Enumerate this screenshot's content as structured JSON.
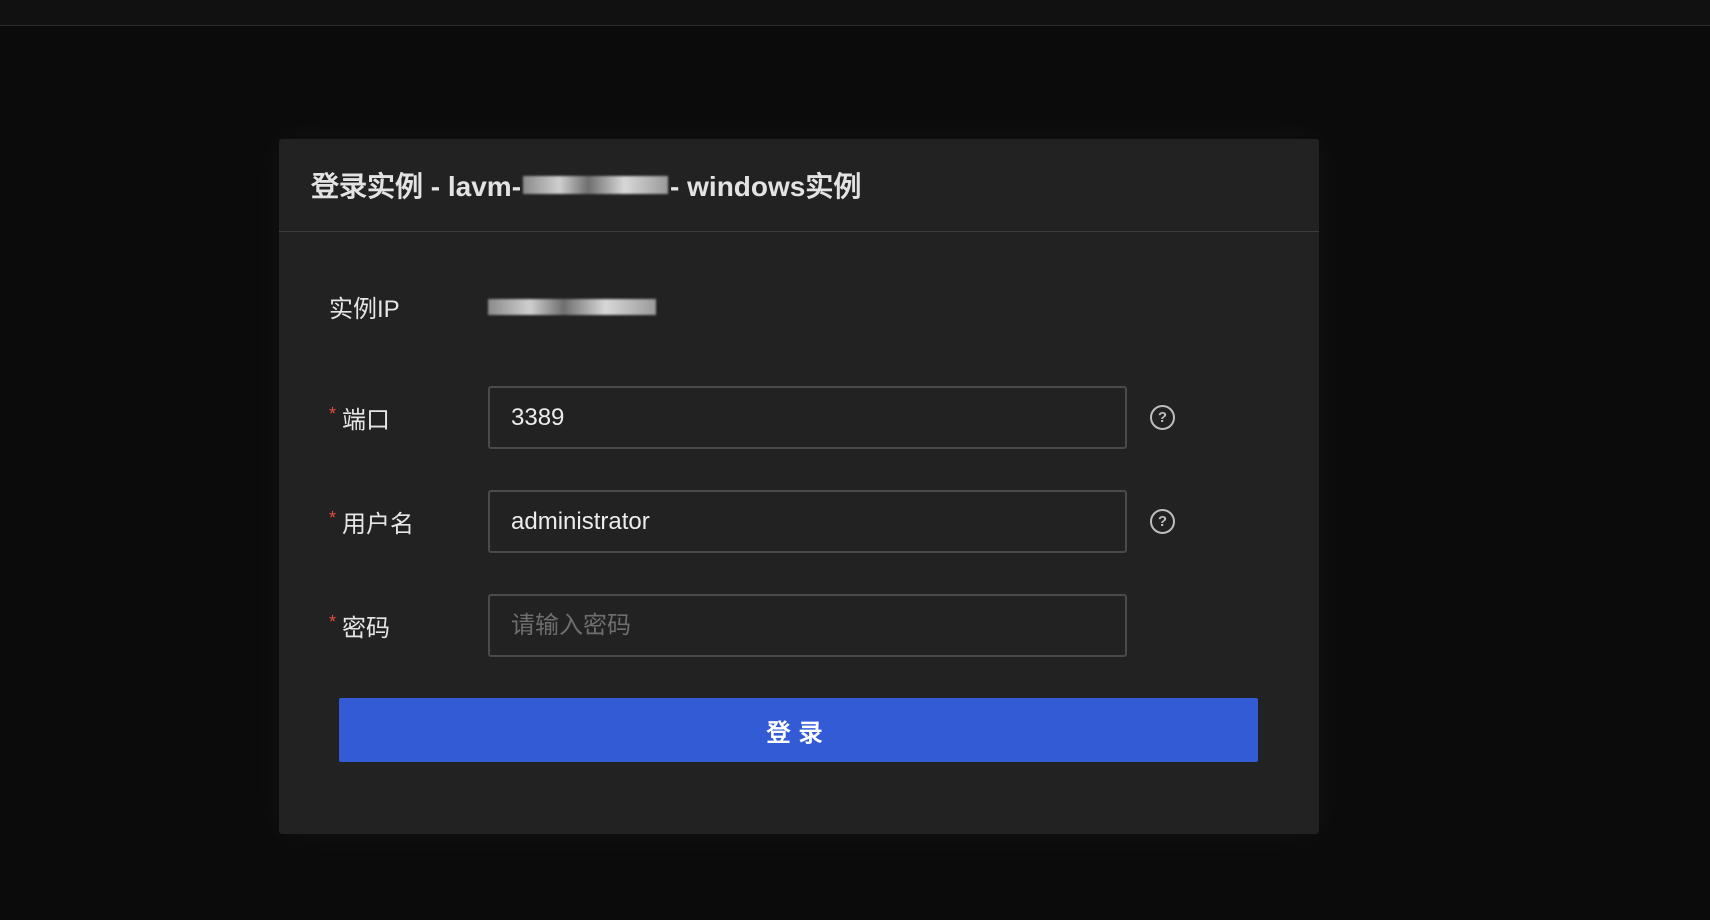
{
  "dialog": {
    "title_prefix": "登录实例 - lavm-",
    "title_suffix": "- windows实例"
  },
  "form": {
    "ip_label": "实例IP",
    "port": {
      "required_mark": "*",
      "label": "端口",
      "value": "3389"
    },
    "username": {
      "required_mark": "*",
      "label": "用户名",
      "value": "administrator"
    },
    "password": {
      "required_mark": "*",
      "label": "密码",
      "value": "",
      "placeholder": "请输入密码"
    },
    "help_glyph": "?",
    "submit_label": "登录"
  },
  "icons": {
    "help": "question-circle-icon"
  },
  "colors": {
    "accent": "#335bd6",
    "required": "#e74c3c",
    "background": "#0b0b0b",
    "panel": "#222222"
  }
}
